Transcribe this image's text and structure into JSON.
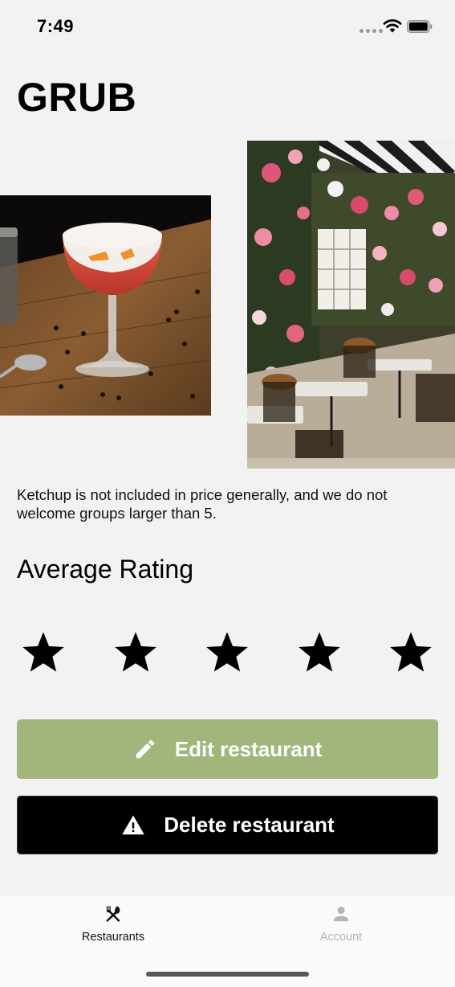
{
  "status_bar": {
    "time": "7:49"
  },
  "page": {
    "title": "GRUB",
    "description": "Ketchup is not included in price generally, and we do not welcome groups larger than 5.",
    "rating_heading": "Average Rating",
    "rating_value": 5,
    "rating_max": 5
  },
  "actions": {
    "edit_label": "Edit restaurant",
    "delete_label": "Delete restaurant"
  },
  "tab_bar": {
    "tabs": [
      {
        "label": "Restaurants",
        "icon": "fork-knife-icon",
        "active": true
      },
      {
        "label": "Account",
        "icon": "person-icon",
        "active": false
      }
    ]
  },
  "colors": {
    "edit_button": "#a2b67c",
    "delete_button": "#000000",
    "background": "#f2f2f2",
    "active_tab": "#111111",
    "inactive_tab": "#b5b5b5"
  }
}
